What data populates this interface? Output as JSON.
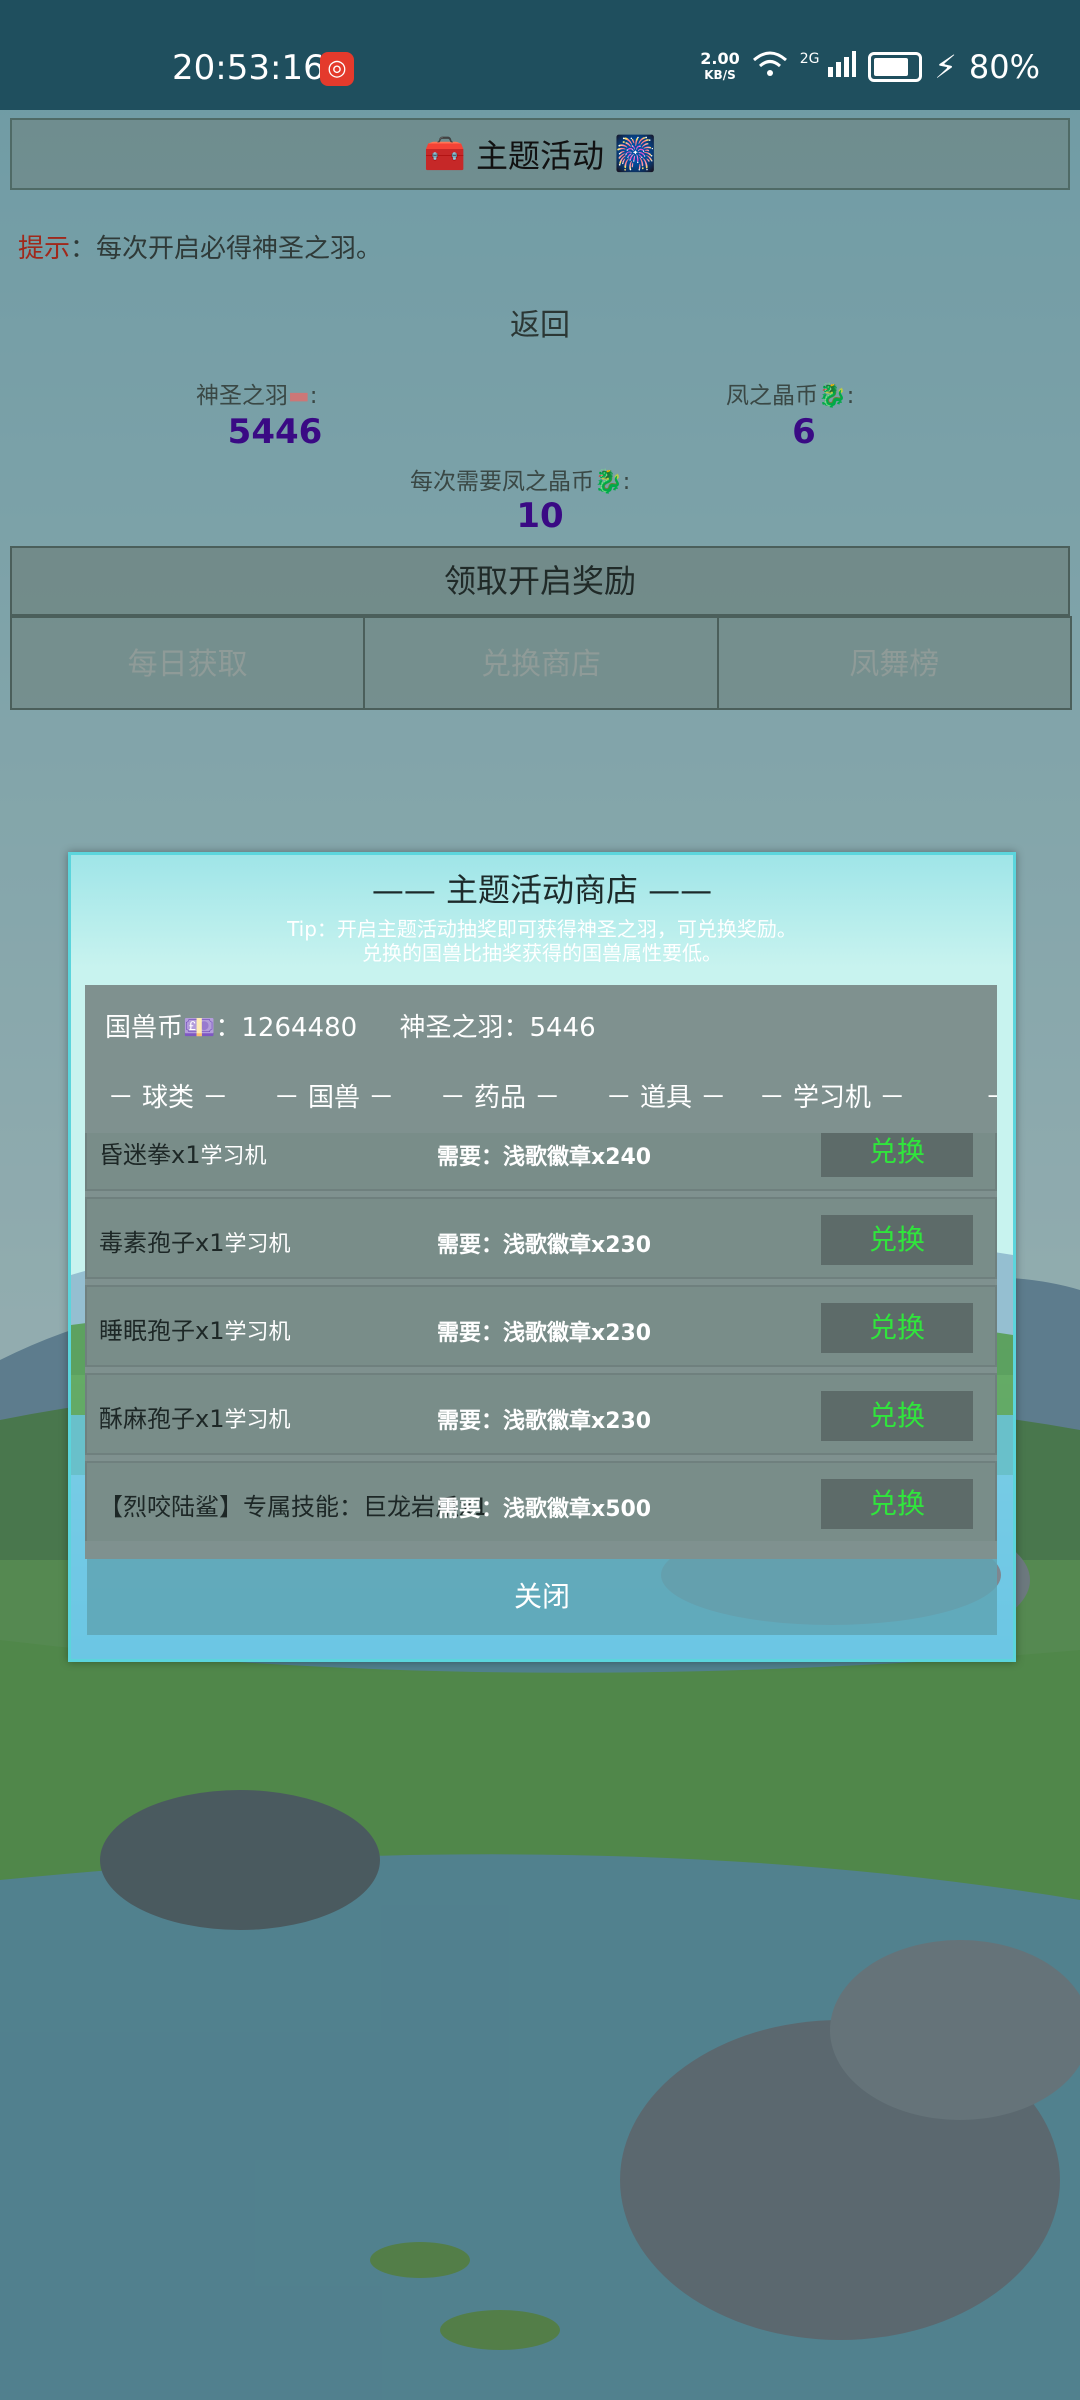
{
  "status_bar": {
    "time": "20:53:16",
    "net_speed_value": "2.00",
    "net_speed_unit": "KB/S",
    "signal_label": "2G",
    "battery": "80%"
  },
  "header": {
    "title": "主题活动"
  },
  "hint": {
    "label": "提示",
    "text": "：每次开启必得神圣之羽。"
  },
  "back_link": "返回",
  "stats": {
    "feather_label": "神圣之羽",
    "feather_value": "5446",
    "coin_label": "凤之晶币",
    "coin_value": "6",
    "cost_label": "每次需要凤之晶币",
    "cost_value": "10"
  },
  "claim_button": "领取开启奖励",
  "nav_tabs": [
    "每日获取",
    "兑换商店",
    "凤舞榜"
  ],
  "shop": {
    "title": "—— 主题活动商店 ——",
    "tip_line1": "Tip：开启主题活动抽奖即可获得神圣之羽，可兑换奖励。",
    "tip_line2": "兑换的国兽比抽奖获得的国兽属性要低。",
    "balance_coin_label": "国兽币",
    "balance_coin_value": "：1264480",
    "balance_feather": "神圣之羽：5446",
    "categories": [
      "－ 球类 －",
      "－ 国兽 －",
      "－ 药品 －",
      "－ 道具 －",
      "－ 学习机 －",
      "－"
    ],
    "items": [
      {
        "name": "昏迷拳x1",
        "sub": "学习机",
        "need": "需要：浅歌徽章x240",
        "btn": "兑换"
      },
      {
        "name": "毒素孢子x1",
        "sub": "学习机",
        "need": "需要：浅歌徽章x230",
        "btn": "兑换"
      },
      {
        "name": "睡眠孢子x1",
        "sub": "学习机",
        "need": "需要：浅歌徽章x230",
        "btn": "兑换"
      },
      {
        "name": "酥麻孢子x1",
        "sub": "学习机",
        "need": "需要：浅歌徽章x230",
        "btn": "兑换"
      },
      {
        "name": "【烈咬陆鲨】专属技能：巨龙岩爪x1",
        "sub": "",
        "need": "需要：浅歌徽章x500",
        "btn": "兑换"
      }
    ],
    "close_button": "关闭"
  }
}
